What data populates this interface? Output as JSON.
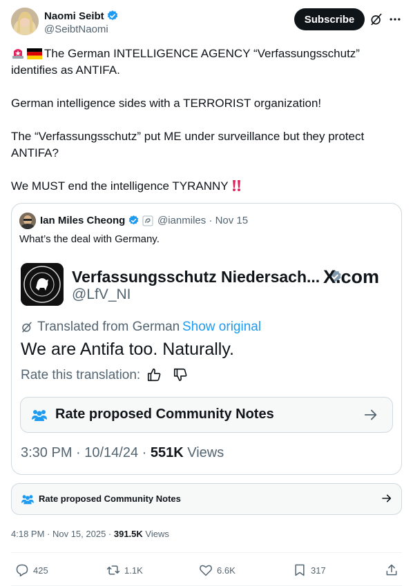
{
  "author": {
    "name": "Naomi Seibt",
    "handle": "@SeibtNaomi",
    "subscribe_label": "Subscribe"
  },
  "tweet": {
    "paragraphs": [
      "The German INTELLIGENCE AGENCY “Verfassungsschutz” identifies as ANTIFA.",
      "German intelligence sides with a TERRORIST organization!",
      "The “Verfassungsschutz” put ME under surveillance but they protect ANTIFA?",
      "We MUST end the intelligence TYRANNY"
    ],
    "emoji": [
      "🚨",
      "🇩🇪",
      "‼️"
    ]
  },
  "quote": {
    "name": "Ian Miles Cheong",
    "handle": "@ianmiles · Nov 15",
    "text": "What’s the deal with Germany.",
    "embedded": {
      "account_name": "Verfassungsschutz Niedersach...",
      "account_handle": "@LfV_NI",
      "site": "X.com",
      "translated_label": "Translated from German",
      "show_original": "Show original",
      "post_text": "We are Antifa too. Naturally.",
      "rate_translation": "Rate this translation:",
      "notes_label": "Rate proposed Community Notes",
      "time": "3:30 PM · 10/14/24 · ",
      "views_count": "551K",
      "views_label": " Views"
    }
  },
  "community_notes": {
    "label": "Rate proposed Community Notes"
  },
  "meta": {
    "time": "4:18 PM · Nov 15, 2025 · ",
    "views_count": "391.5K",
    "views_label": " Views"
  },
  "actions": {
    "replies": "425",
    "reposts": "1.1K",
    "likes": "6.6K",
    "bookmarks": "317"
  },
  "colors": {
    "verified": "#1d9bf0",
    "gray_verified": "#829aab",
    "link": "#1d9bf0",
    "text": "#0f1419",
    "muted": "#536471",
    "border": "#cfd9de"
  },
  "icons": [
    "verified-badge-icon",
    "grok-icon",
    "more-icon",
    "siren-icon",
    "german-flag-icon",
    "double-exclamation-icon",
    "translate-icon",
    "thumbs-up-icon",
    "thumbs-down-icon",
    "community-notes-icon",
    "arrow-right-icon",
    "reply-icon",
    "repost-icon",
    "like-icon",
    "bookmark-icon",
    "share-icon"
  ]
}
